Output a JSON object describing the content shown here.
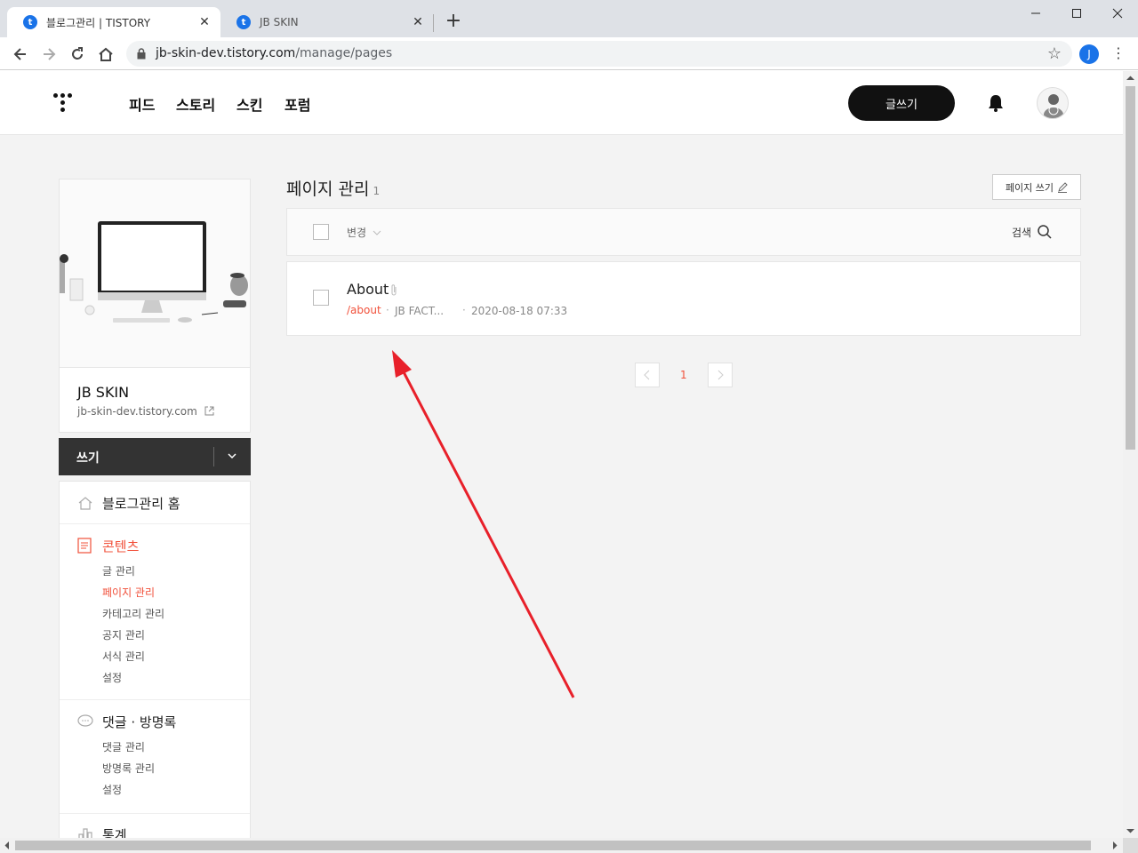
{
  "browser": {
    "tabs": [
      {
        "title": "블로그관리 | TISTORY",
        "favicon": "t"
      },
      {
        "title": "JB SKIN",
        "favicon": "t"
      }
    ],
    "url_host": "jb-skin-dev.tistory.com",
    "url_path": "/manage/pages",
    "profile_initial": "J"
  },
  "header": {
    "nav": [
      "피드",
      "스토리",
      "스킨",
      "포럼"
    ],
    "write_label": "글쓰기"
  },
  "sidebar": {
    "blog_name": "JB SKIN",
    "blog_url": "jb-skin-dev.tistory.com",
    "write_label": "쓰기",
    "home": "블로그관리 홈",
    "contents": {
      "title": "콘텐츠",
      "items": [
        "글 관리",
        "페이지 관리",
        "카테고리 관리",
        "공지 관리",
        "서식 관리",
        "설정"
      ]
    },
    "comments": {
      "title": "댓글 · 방명록",
      "items": [
        "댓글 관리",
        "방명록 관리",
        "설정"
      ]
    },
    "stats": "통계"
  },
  "main": {
    "title": "페이지 관리",
    "count": "1",
    "write_page_label": "페이지 쓰기",
    "change_label": "변경",
    "search_label": "검색",
    "rows": [
      {
        "title": "About",
        "slug": "/about",
        "author": "JB FACT...",
        "date": "2020-08-18 07:33"
      }
    ],
    "current_page": "1"
  },
  "colors": {
    "accent": "#f1503a",
    "arrow": "#e8202a"
  }
}
